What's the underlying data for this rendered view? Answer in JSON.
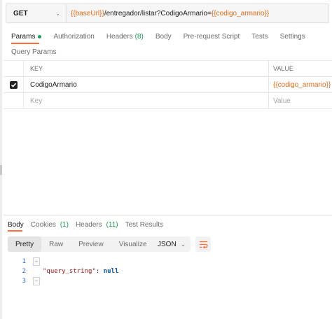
{
  "request": {
    "method": "GET",
    "url_parts": {
      "base_var": "{{baseUrl}}",
      "path": "/entregador/listar?CodigoArmario=",
      "param_var": "{{codigo_armario}}"
    }
  },
  "request_tabs": {
    "params": "Params",
    "authorization": "Authorization",
    "headers": "Headers",
    "headers_count": "(8)",
    "body": "Body",
    "prerequest": "Pre-request Script",
    "tests": "Tests",
    "settings": "Settings"
  },
  "query_params": {
    "title": "Query Params",
    "header_key": "KEY",
    "header_value": "VALUE",
    "rows": [
      {
        "key": "CodigoArmario",
        "value": "{{codigo_armario}}",
        "checked": true
      }
    ],
    "placeholder_key": "Key",
    "placeholder_value": "Value"
  },
  "response_tabs": {
    "body": "Body",
    "cookies": "Cookies",
    "cookies_count": "(1)",
    "headers": "Headers",
    "headers_count": "(11)",
    "test_results": "Test Results"
  },
  "format_toolbar": {
    "pretty": "Pretty",
    "raw": "Raw",
    "preview": "Preview",
    "visualize": "Visualize",
    "format": "JSON"
  },
  "response_body": {
    "line_numbers": [
      "1",
      "2",
      "3"
    ],
    "json_key": "\"query_string\"",
    "json_colon": ": ",
    "json_value": "null"
  },
  "colors": {
    "accent": "#ff6c37",
    "variable": "#e36d1a",
    "status_green": "#1e9e5a"
  }
}
